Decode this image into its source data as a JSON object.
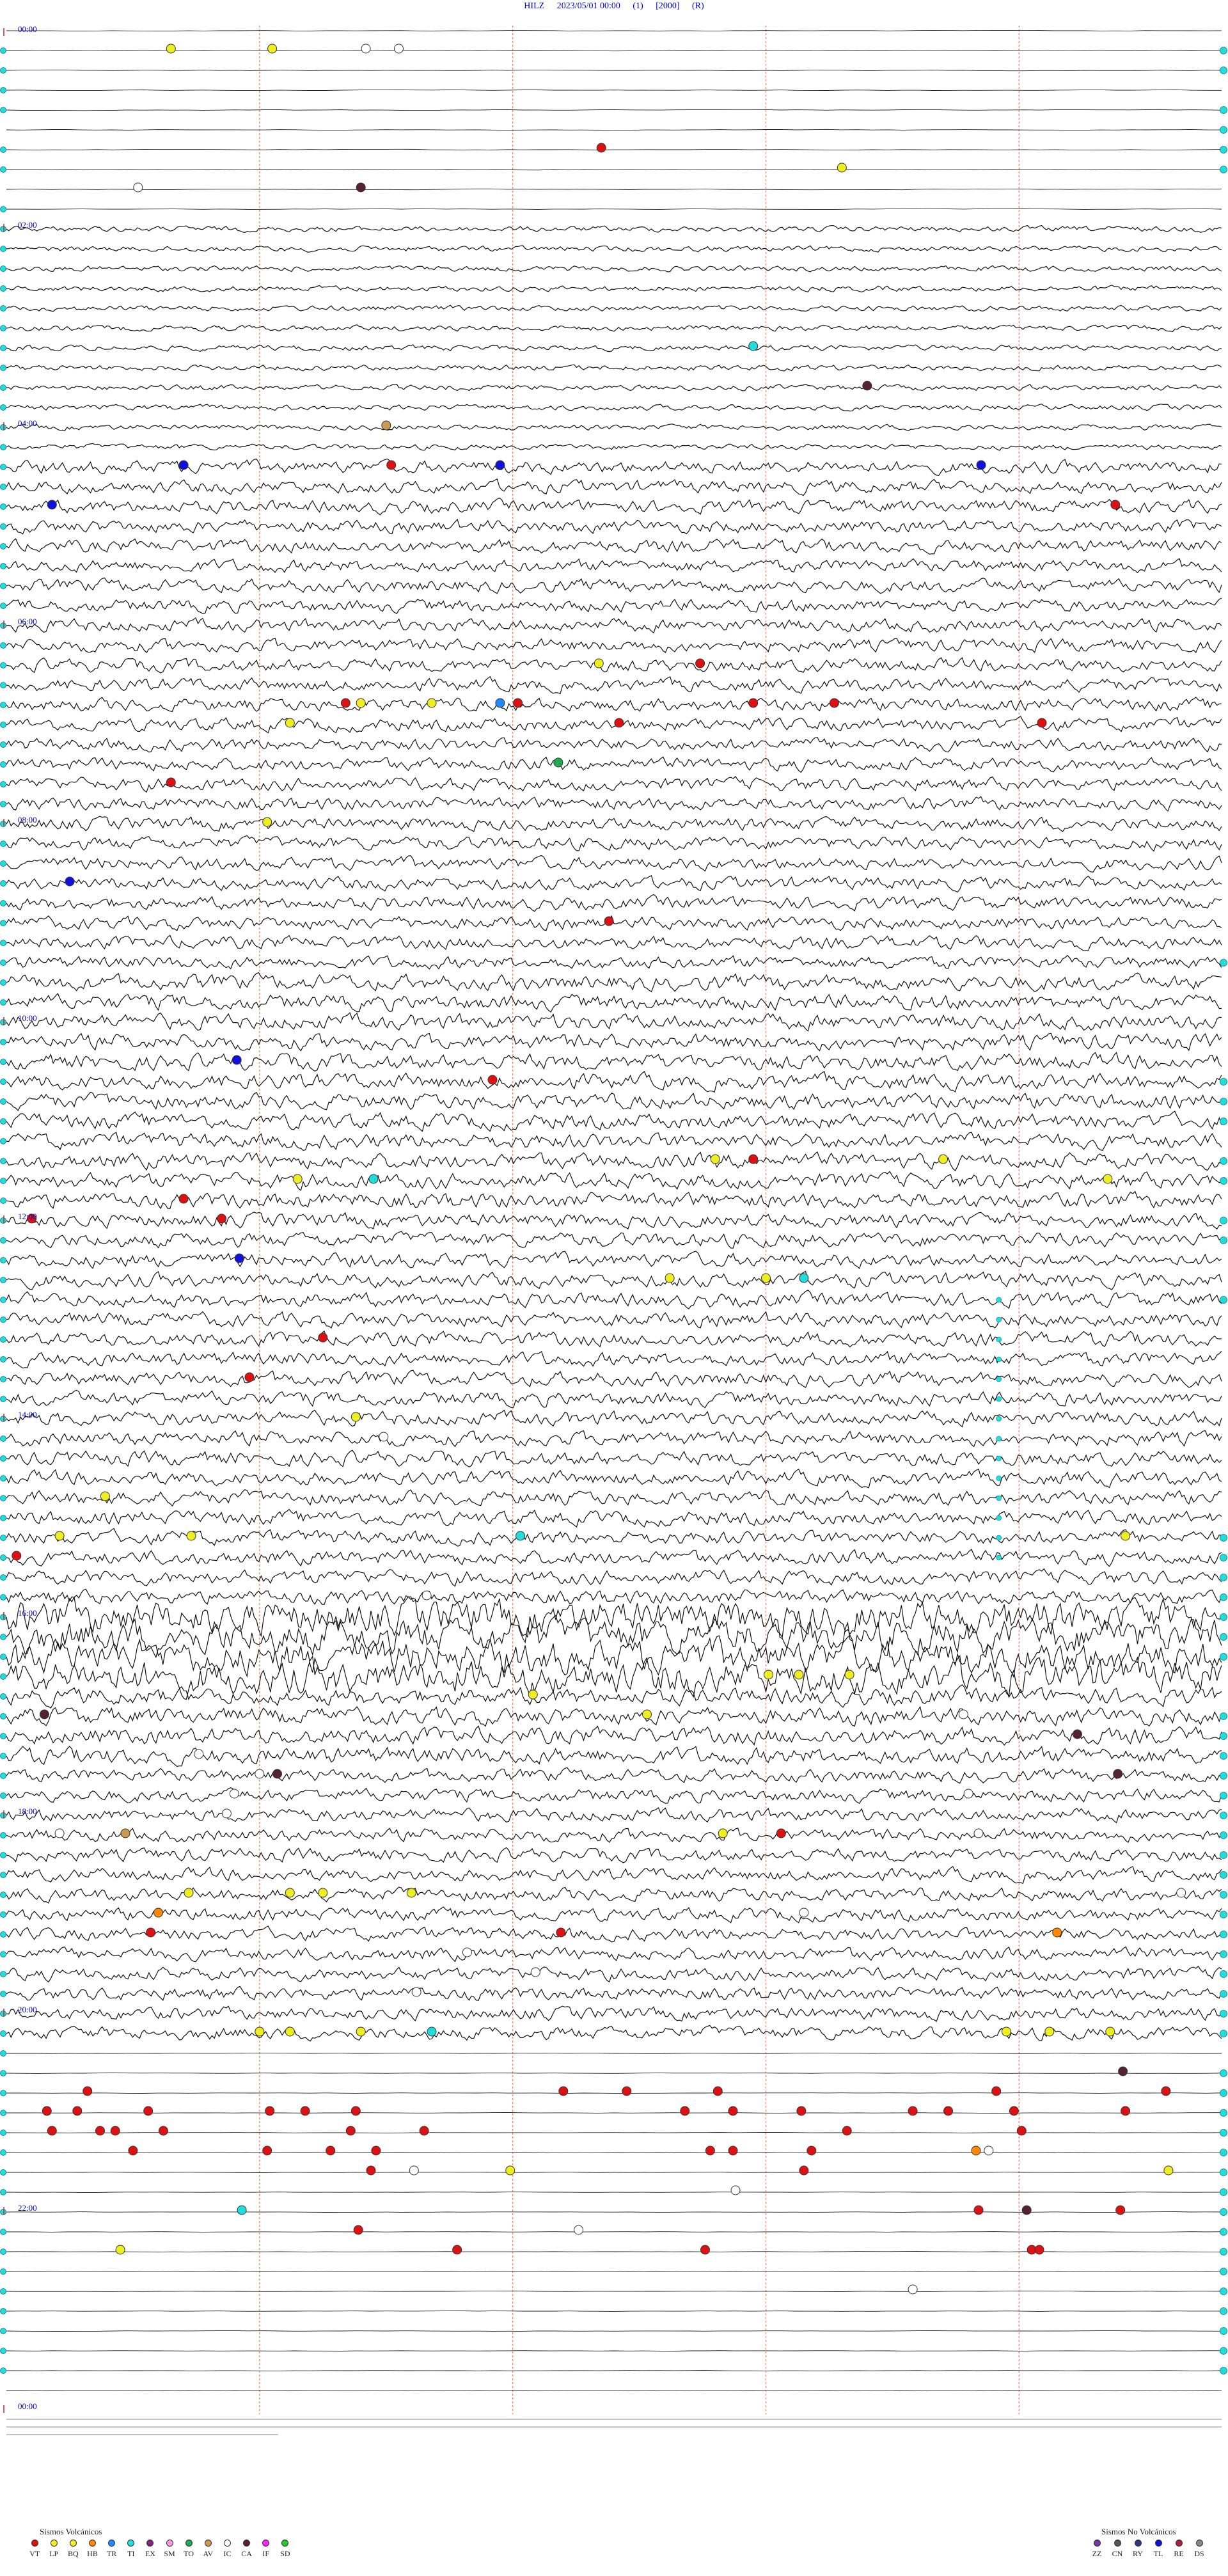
{
  "header": {
    "station": "HILZ",
    "datetime": "2023/05/01 00:00",
    "field1": "(1)",
    "scale": "[2000]",
    "field3": "(R)"
  },
  "chart_data": {
    "type": "helicorder",
    "time_range_hours": [
      0,
      24
    ],
    "rows_per_hour": 5,
    "row_count": 120,
    "minute_guides": [
      10,
      20,
      30,
      40
    ],
    "hour_labels": [
      {
        "hour": 0,
        "text": "00:00"
      },
      {
        "hour": 2,
        "text": "02:00"
      },
      {
        "hour": 4,
        "text": "04:00"
      },
      {
        "hour": 6,
        "text": "06:00"
      },
      {
        "hour": 8,
        "text": "08:00"
      },
      {
        "hour": 10,
        "text": "10:00"
      },
      {
        "hour": 12,
        "text": "12:00"
      },
      {
        "hour": 14,
        "text": "14:00"
      },
      {
        "hour": 16,
        "text": "16:00"
      },
      {
        "hour": 18,
        "text": "18:00"
      },
      {
        "hour": 20,
        "text": "20:00"
      },
      {
        "hour": 22,
        "text": "22:00"
      },
      {
        "hour": 24,
        "text": "00:00"
      }
    ],
    "activity": [
      {
        "rows": [
          0,
          9
        ],
        "amp": 0.6
      },
      {
        "rows": [
          10,
          21
        ],
        "amp": 4
      },
      {
        "rows": [
          22,
          47
        ],
        "amp": 9
      },
      {
        "rows": [
          48,
          59
        ],
        "amp": 11
      },
      {
        "rows": [
          60,
          79
        ],
        "amp": 10
      },
      {
        "rows": [
          80,
          83
        ],
        "amp": 24
      },
      {
        "rows": [
          84,
          87
        ],
        "amp": 12
      },
      {
        "rows": [
          88,
          101
        ],
        "amp": 9
      },
      {
        "rows": [
          102,
          105
        ],
        "amp": 0.4
      },
      {
        "rows": [
          106,
          119
        ],
        "amp": 0.4
      }
    ],
    "events": [
      {
        "row": 1,
        "minute": 6.5,
        "type": "BQ"
      },
      {
        "row": 1,
        "minute": 10.5,
        "type": "BQ"
      },
      {
        "row": 1,
        "minute": 14.2,
        "type": "IC"
      },
      {
        "row": 1,
        "minute": 15.5,
        "type": "IC"
      },
      {
        "row": 6,
        "minute": 23.5,
        "type": "VT"
      },
      {
        "row": 7,
        "minute": 33,
        "type": "BQ"
      },
      {
        "row": 8,
        "minute": 5.2,
        "type": "IC"
      },
      {
        "row": 8,
        "minute": 14,
        "type": "CA"
      },
      {
        "row": 16,
        "minute": 29.5,
        "type": "TI"
      },
      {
        "row": 18,
        "minute": 34,
        "type": "CA"
      },
      {
        "row": 20,
        "minute": 15,
        "type": "AV"
      },
      {
        "row": 22,
        "minute": 7,
        "type": "TL"
      },
      {
        "row": 22,
        "minute": 15.2,
        "type": "VT"
      },
      {
        "row": 22,
        "minute": 19.5,
        "type": "TL"
      },
      {
        "row": 22,
        "minute": 38.5,
        "type": "TL"
      },
      {
        "row": 24,
        "minute": 1.8,
        "type": "TL"
      },
      {
        "row": 24,
        "minute": 43.8,
        "type": "VT"
      },
      {
        "row": 32,
        "minute": 23.4,
        "type": "BQ"
      },
      {
        "row": 32,
        "minute": 27.4,
        "type": "VT"
      },
      {
        "row": 34,
        "minute": 13.4,
        "type": "VT"
      },
      {
        "row": 34,
        "minute": 14,
        "type": "BQ"
      },
      {
        "row": 34,
        "minute": 16.8,
        "type": "BQ"
      },
      {
        "row": 34,
        "minute": 19.5,
        "type": "TR"
      },
      {
        "row": 34,
        "minute": 20.2,
        "type": "VT"
      },
      {
        "row": 34,
        "minute": 29.5,
        "type": "VT"
      },
      {
        "row": 34,
        "minute": 32.7,
        "type": "VT"
      },
      {
        "row": 35,
        "minute": 11.2,
        "type": "BQ"
      },
      {
        "row": 35,
        "minute": 24.2,
        "type": "VT"
      },
      {
        "row": 35,
        "minute": 40.9,
        "type": "VT"
      },
      {
        "row": 37,
        "minute": 21.8,
        "type": "TO"
      },
      {
        "row": 38,
        "minute": 6.5,
        "type": "VT"
      },
      {
        "row": 40,
        "minute": 10.3,
        "type": "BQ"
      },
      {
        "row": 43,
        "minute": 2.5,
        "type": "TL"
      },
      {
        "row": 45,
        "minute": 23.8,
        "type": "VT"
      },
      {
        "row": 52,
        "minute": 9.1,
        "type": "TL"
      },
      {
        "row": 53,
        "minute": 19.2,
        "type": "VT"
      },
      {
        "row": 57,
        "minute": 28,
        "type": "BQ"
      },
      {
        "row": 57,
        "minute": 29.5,
        "type": "VT"
      },
      {
        "row": 57,
        "minute": 37,
        "type": "BQ"
      },
      {
        "row": 58,
        "minute": 11.5,
        "type": "BQ"
      },
      {
        "row": 58,
        "minute": 14.5,
        "type": "TI"
      },
      {
        "row": 58,
        "minute": 43.5,
        "type": "BQ"
      },
      {
        "row": 59,
        "minute": 7,
        "type": "VT"
      },
      {
        "row": 60,
        "minute": 1,
        "type": "VT"
      },
      {
        "row": 60,
        "minute": 8.5,
        "type": "VT"
      },
      {
        "row": 62,
        "minute": 9.2,
        "type": "TL"
      },
      {
        "row": 63,
        "minute": 26.2,
        "type": "BQ"
      },
      {
        "row": 63,
        "minute": 30,
        "type": "BQ"
      },
      {
        "row": 63,
        "minute": 31.5,
        "type": "TI"
      },
      {
        "row": 66,
        "minute": 12.5,
        "type": "VT"
      },
      {
        "row": 68,
        "minute": 9.6,
        "type": "VT"
      },
      {
        "row": 70,
        "minute": 13.8,
        "type": "BQ"
      },
      {
        "row": 71,
        "minute": 14.9,
        "type": "IC"
      },
      {
        "row": 74,
        "minute": 3.9,
        "type": "BQ"
      },
      {
        "row": 76,
        "minute": 2.1,
        "type": "BQ"
      },
      {
        "row": 76,
        "minute": 7.3,
        "type": "BQ"
      },
      {
        "row": 76,
        "minute": 20.3,
        "type": "TI"
      },
      {
        "row": 76,
        "minute": 44.2,
        "type": "BQ"
      },
      {
        "row": 77,
        "minute": 0.4,
        "type": "VT"
      },
      {
        "row": 79,
        "minute": 16.6,
        "type": "IC"
      },
      {
        "row": 83,
        "minute": 30.1,
        "type": "BQ"
      },
      {
        "row": 83,
        "minute": 31.3,
        "type": "BQ"
      },
      {
        "row": 83,
        "minute": 33.3,
        "type": "BQ"
      },
      {
        "row": 84,
        "minute": 20.8,
        "type": "BQ"
      },
      {
        "row": 85,
        "minute": 1.5,
        "type": "CA"
      },
      {
        "row": 85,
        "minute": 25.3,
        "type": "BQ"
      },
      {
        "row": 85,
        "minute": 37.8,
        "type": "IC"
      },
      {
        "row": 86,
        "minute": 42.3,
        "type": "CA"
      },
      {
        "row": 87,
        "minute": 7.6,
        "type": "IC"
      },
      {
        "row": 88,
        "minute": 10,
        "type": "IC"
      },
      {
        "row": 88,
        "minute": 10.7,
        "type": "CA"
      },
      {
        "row": 88,
        "minute": 43.9,
        "type": "CA"
      },
      {
        "row": 89,
        "minute": 9,
        "type": "IC"
      },
      {
        "row": 89,
        "minute": 38,
        "type": "IC"
      },
      {
        "row": 90,
        "minute": 8.7,
        "type": "IC"
      },
      {
        "row": 91,
        "minute": 2.1,
        "type": "IC"
      },
      {
        "row": 91,
        "minute": 4.7,
        "type": "AV"
      },
      {
        "row": 91,
        "minute": 28.3,
        "type": "BQ"
      },
      {
        "row": 91,
        "minute": 30.6,
        "type": "VT"
      },
      {
        "row": 91,
        "minute": 38.4,
        "type": "IC"
      },
      {
        "row": 94,
        "minute": 7.2,
        "type": "BQ"
      },
      {
        "row": 94,
        "minute": 11.2,
        "type": "BQ"
      },
      {
        "row": 94,
        "minute": 12.5,
        "type": "BQ"
      },
      {
        "row": 94,
        "minute": 16,
        "type": "BQ"
      },
      {
        "row": 94,
        "minute": 46.4,
        "type": "IC"
      },
      {
        "row": 95,
        "minute": 6,
        "type": "HB"
      },
      {
        "row": 95,
        "minute": 31.5,
        "type": "IC"
      },
      {
        "row": 96,
        "minute": 5.7,
        "type": "VT"
      },
      {
        "row": 96,
        "minute": 21.9,
        "type": "VT"
      },
      {
        "row": 96,
        "minute": 41.5,
        "type": "HB"
      },
      {
        "row": 97,
        "minute": 18.2,
        "type": "IC"
      },
      {
        "row": 98,
        "minute": 20.9,
        "type": "IC"
      },
      {
        "row": 99,
        "minute": 16.2,
        "type": "IC"
      },
      {
        "row": 101,
        "minute": 10,
        "type": "BQ"
      },
      {
        "row": 101,
        "minute": 11.2,
        "type": "BQ"
      },
      {
        "row": 101,
        "minute": 14,
        "type": "BQ"
      },
      {
        "row": 101,
        "minute": 16.8,
        "type": "TI"
      },
      {
        "row": 101,
        "minute": 39.5,
        "type": "BQ"
      },
      {
        "row": 101,
        "minute": 41.2,
        "type": "BQ"
      },
      {
        "row": 101,
        "minute": 43.6,
        "type": "BQ"
      },
      {
        "row": 103,
        "minute": 44.1,
        "type": "CA"
      },
      {
        "row": 104,
        "minute": 3.2,
        "type": "VT"
      },
      {
        "row": 104,
        "minute": 22,
        "type": "VT"
      },
      {
        "row": 104,
        "minute": 24.5,
        "type": "VT"
      },
      {
        "row": 104,
        "minute": 28.1,
        "type": "VT"
      },
      {
        "row": 104,
        "minute": 39.1,
        "type": "VT"
      },
      {
        "row": 104,
        "minute": 45.8,
        "type": "VT"
      },
      {
        "row": 105,
        "minute": 1.6,
        "type": "VT"
      },
      {
        "row": 105,
        "minute": 2.8,
        "type": "VT"
      },
      {
        "row": 105,
        "minute": 5.6,
        "type": "VT"
      },
      {
        "row": 105,
        "minute": 10.4,
        "type": "VT"
      },
      {
        "row": 105,
        "minute": 11.8,
        "type": "VT"
      },
      {
        "row": 105,
        "minute": 13.8,
        "type": "VT"
      },
      {
        "row": 105,
        "minute": 26.8,
        "type": "VT"
      },
      {
        "row": 105,
        "minute": 28.7,
        "type": "VT"
      },
      {
        "row": 105,
        "minute": 31.4,
        "type": "VT"
      },
      {
        "row": 105,
        "minute": 35.8,
        "type": "VT"
      },
      {
        "row": 105,
        "minute": 37.2,
        "type": "VT"
      },
      {
        "row": 105,
        "minute": 39.8,
        "type": "VT"
      },
      {
        "row": 105,
        "minute": 44.2,
        "type": "VT"
      },
      {
        "row": 106,
        "minute": 1.8,
        "type": "VT"
      },
      {
        "row": 106,
        "minute": 3.7,
        "type": "VT"
      },
      {
        "row": 106,
        "minute": 4.3,
        "type": "VT"
      },
      {
        "row": 106,
        "minute": 6.2,
        "type": "VT"
      },
      {
        "row": 106,
        "minute": 13.6,
        "type": "VT"
      },
      {
        "row": 106,
        "minute": 16.5,
        "type": "VT"
      },
      {
        "row": 106,
        "minute": 33.2,
        "type": "VT"
      },
      {
        "row": 106,
        "minute": 40.1,
        "type": "VT"
      },
      {
        "row": 107,
        "minute": 5,
        "type": "VT"
      },
      {
        "row": 107,
        "minute": 10.3,
        "type": "VT"
      },
      {
        "row": 107,
        "minute": 12.8,
        "type": "VT"
      },
      {
        "row": 107,
        "minute": 14.6,
        "type": "VT"
      },
      {
        "row": 107,
        "minute": 27.8,
        "type": "VT"
      },
      {
        "row": 107,
        "minute": 28.7,
        "type": "VT"
      },
      {
        "row": 107,
        "minute": 31.8,
        "type": "VT"
      },
      {
        "row": 107,
        "minute": 38.3,
        "type": "HB"
      },
      {
        "row": 107,
        "minute": 38.8,
        "type": "IC"
      },
      {
        "row": 108,
        "minute": 14.4,
        "type": "VT"
      },
      {
        "row": 108,
        "minute": 16.1,
        "type": "IC"
      },
      {
        "row": 108,
        "minute": 19.9,
        "type": "BQ"
      },
      {
        "row": 108,
        "minute": 31.5,
        "type": "VT"
      },
      {
        "row": 108,
        "minute": 45.9,
        "type": "BQ"
      },
      {
        "row": 109,
        "minute": 28.8,
        "type": "IC"
      },
      {
        "row": 110,
        "minute": 9.3,
        "type": "TI"
      },
      {
        "row": 110,
        "minute": 38.4,
        "type": "VT"
      },
      {
        "row": 110,
        "minute": 40.3,
        "type": "CA"
      },
      {
        "row": 110,
        "minute": 44,
        "type": "VT"
      },
      {
        "row": 111,
        "minute": 13.9,
        "type": "VT"
      },
      {
        "row": 111,
        "minute": 22.6,
        "type": "IC"
      },
      {
        "row": 112,
        "minute": 4.5,
        "type": "BQ"
      },
      {
        "row": 112,
        "minute": 17.8,
        "type": "VT"
      },
      {
        "row": 112,
        "minute": 27.6,
        "type": "VT"
      },
      {
        "row": 112,
        "minute": 40.5,
        "type": "VT"
      },
      {
        "row": 112,
        "minute": 40.8,
        "type": "VT"
      },
      {
        "row": 114,
        "minute": 35.8,
        "type": "IC"
      }
    ],
    "edge_markers": {
      "left_cyan_rows": [
        1,
        2,
        3,
        4,
        6,
        7,
        9,
        10,
        11,
        12,
        13,
        14,
        15,
        16,
        17,
        18,
        19,
        20,
        21,
        22,
        23,
        24,
        25,
        26,
        27,
        28,
        29,
        30,
        31,
        32,
        33,
        34,
        35,
        36,
        37,
        38,
        39,
        40,
        41,
        42,
        43,
        44,
        45,
        46,
        47,
        48,
        49,
        50,
        51,
        52,
        53,
        54,
        55,
        56,
        57,
        58,
        59,
        60,
        61,
        62,
        63,
        64,
        65,
        66,
        67,
        68,
        69,
        70,
        71,
        72,
        73,
        74,
        75,
        76,
        77,
        78,
        79,
        80,
        81,
        82,
        83,
        84,
        85,
        86,
        87,
        88,
        89,
        90,
        91,
        92,
        93,
        94,
        95,
        96,
        97,
        98,
        99,
        100,
        101,
        102,
        103,
        104,
        105,
        106,
        107,
        108,
        109,
        110,
        111,
        112,
        113,
        114,
        115,
        116,
        117,
        118
      ],
      "right_cyan_rows": [
        1,
        2,
        4,
        5,
        6,
        7,
        47,
        53,
        54,
        55,
        57,
        58,
        60,
        61,
        64,
        76,
        77,
        78,
        79,
        80,
        81,
        82,
        85,
        86,
        87,
        88,
        89,
        90,
        91,
        92,
        93,
        94,
        95,
        96,
        97,
        98,
        99,
        100,
        101,
        103,
        104,
        105,
        106,
        107,
        108,
        109,
        110,
        111,
        112,
        113,
        114,
        115,
        116,
        117,
        118
      ],
      "cyan_column": {
        "minute": 39.2,
        "rows": [
          64,
          77
        ]
      }
    }
  },
  "legend_volcanic": {
    "title": "Sismos Volcánicos",
    "items": [
      {
        "code": "VT",
        "color": "#dd1111"
      },
      {
        "code": "LP",
        "color": "#eeee22"
      },
      {
        "code": "BQ",
        "color": "#eeee22"
      },
      {
        "code": "HB",
        "color": "#ff8800"
      },
      {
        "code": "TR",
        "color": "#2288ff"
      },
      {
        "code": "TI",
        "color": "#22dddd"
      },
      {
        "code": "EX",
        "color": "#882288"
      },
      {
        "code": "SM",
        "color": "#ff99dd"
      },
      {
        "code": "TO",
        "color": "#22aa55"
      },
      {
        "code": "AV",
        "color": "#cc9955"
      },
      {
        "code": "IC",
        "color": "#ffffff"
      },
      {
        "code": "CA",
        "color": "#552233"
      },
      {
        "code": "IF",
        "color": "#ff22ff"
      },
      {
        "code": "SD",
        "color": "#22cc22"
      }
    ]
  },
  "legend_nonvolcanic": {
    "title": "Sismos No Volcánicos",
    "items": [
      {
        "code": "ZZ",
        "color": "#7733aa"
      },
      {
        "code": "CN",
        "color": "#555555"
      },
      {
        "code": "RY",
        "color": "#333388"
      },
      {
        "code": "TL",
        "color": "#1111dd"
      },
      {
        "code": "RE",
        "color": "#aa2244"
      },
      {
        "code": "DS",
        "color": "#888888"
      }
    ]
  }
}
